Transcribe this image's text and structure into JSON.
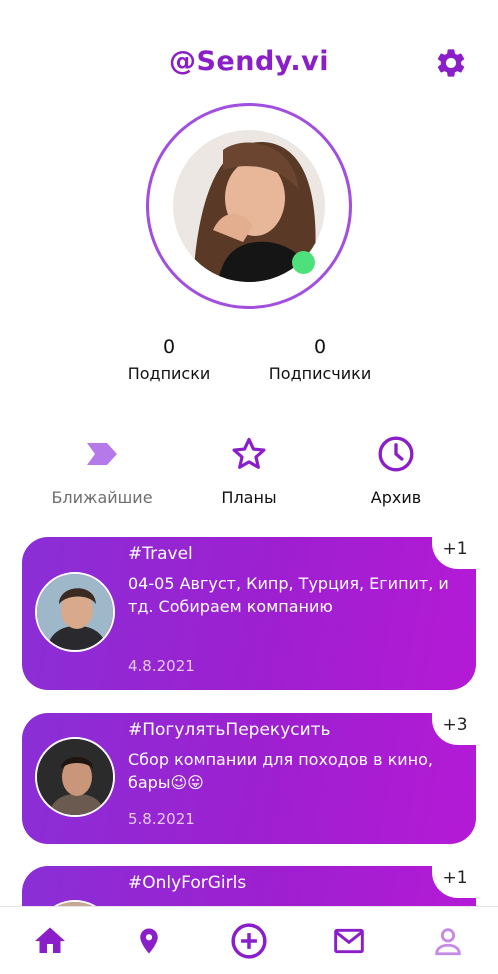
{
  "profile": {
    "username": "@Sendy.vi",
    "online": true,
    "stats": [
      {
        "count": "0",
        "label": "Подписки"
      },
      {
        "count": "0",
        "label": "Подписчики"
      }
    ]
  },
  "tabs": [
    {
      "label": "Ближайшие",
      "icon": "chevron-tag-icon",
      "active": true
    },
    {
      "label": "Планы",
      "icon": "star-outline-icon"
    },
    {
      "label": "Архив",
      "icon": "clock-icon"
    }
  ],
  "posts": [
    {
      "tag": "#Travel",
      "text": "04-05 Август, Кипр, Турция, Египит, и тд. Собираем компанию",
      "date": "4.8.2021",
      "badge": "+1"
    },
    {
      "tag": "#ПогулятьПерекусить",
      "text": "Сбор компании для походов в кино, бары😉😛",
      "date": "5.8.2021",
      "badge": "+3"
    },
    {
      "tag": "#OnlyForGirls",
      "text": "",
      "date": "",
      "badge": "+1"
    }
  ],
  "nav": [
    {
      "icon": "home-icon"
    },
    {
      "icon": "location-pin-icon"
    },
    {
      "icon": "add-circle-icon"
    },
    {
      "icon": "mail-icon"
    },
    {
      "icon": "profile-icon"
    }
  ],
  "colors": {
    "accent": "#8a1fc9",
    "card": "#9b22d3",
    "online": "#4ee07b",
    "inactive_tab": "#6e6e6e"
  }
}
